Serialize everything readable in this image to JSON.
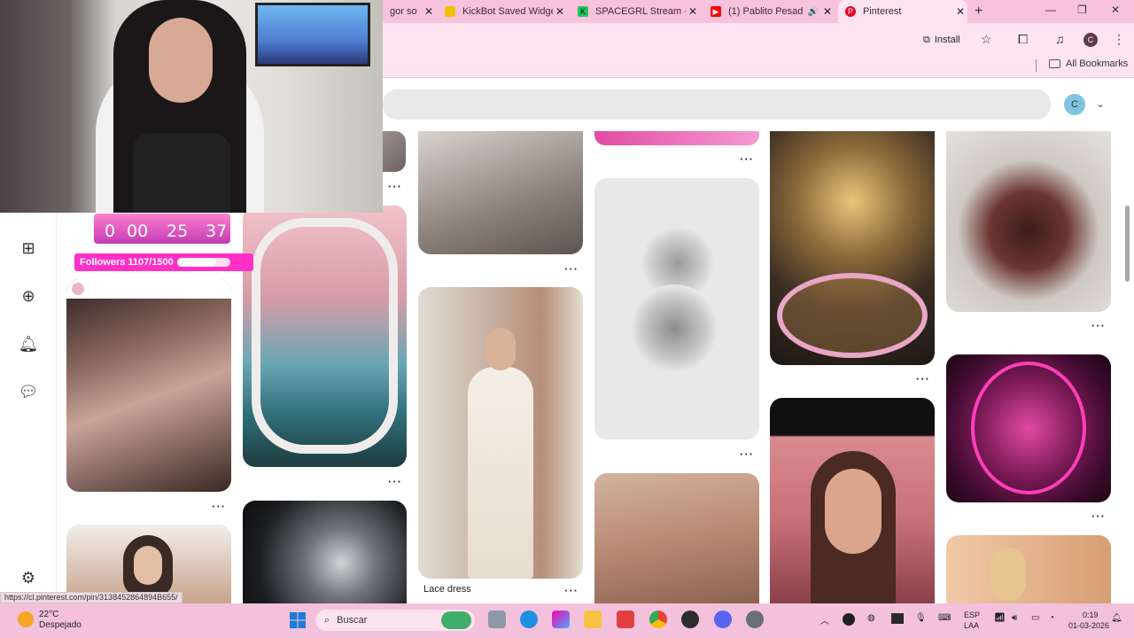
{
  "tabs": [
    {
      "title": "gor so",
      "icon": "generic-tab-icon",
      "color": "#888888"
    },
    {
      "title": "KickBot Saved Widge",
      "icon": "kickbot-icon",
      "color": "#f2c200"
    },
    {
      "title": "SPACEGRL Stream - V",
      "icon": "kick-icon",
      "color": "#22c55e"
    },
    {
      "title": "(1) Pablito Pesad",
      "icon": "youtube-icon",
      "color": "#ff0000"
    },
    {
      "title": "Pinterest",
      "icon": "pinterest-icon",
      "color": "#e60023"
    }
  ],
  "toolbar": {
    "install_label": "Install",
    "profile_initial": "C"
  },
  "bookmarks": {
    "all_label": "All Bookmarks"
  },
  "pinterest": {
    "avatar_initial": "C",
    "pin_captions": {
      "lace_dress": "Lace dress"
    }
  },
  "stream_overlay": {
    "countdown": {
      "days": "0",
      "hours": "00",
      "minutes": "25",
      "seconds": "37"
    },
    "followers_label": "Followers 1107/1500",
    "followers_current": 1107,
    "followers_goal": 1500,
    "followers_progress": 0.738
  },
  "status_url": "https://cl.pinterest.com/pin/3138452864894B655/",
  "taskbar": {
    "temperature": "22°C",
    "weather": "Despejado",
    "search_label": "Buscar",
    "lang_line1": "ESP",
    "lang_line2": "LAA",
    "time": "0:19",
    "date": "01-03-2026"
  },
  "colors": {
    "tabbar": "#f8c2dd",
    "toolbar": "#fde4f0",
    "taskbar": "#f3c1dc",
    "accent": "#ff2fc8"
  }
}
